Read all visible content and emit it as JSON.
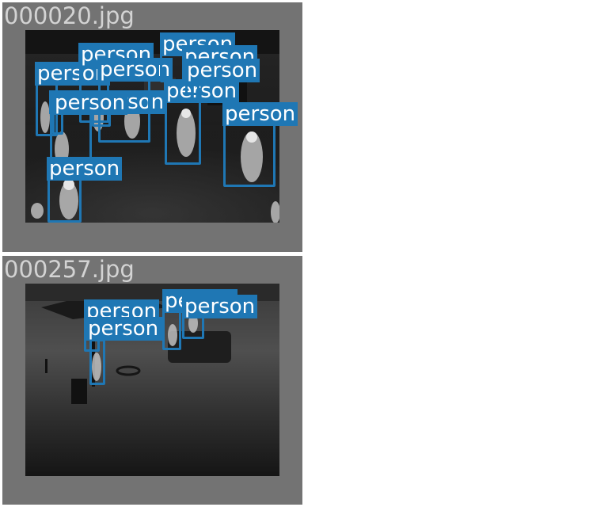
{
  "panels": [
    {
      "filename": "000020.jpg",
      "detections": [
        "person",
        "person",
        "person",
        "person",
        "person",
        "person",
        "person",
        "person",
        "person",
        "person",
        "person",
        "person"
      ]
    },
    {
      "filename": "000257.jpg",
      "detections": [
        "person",
        "person",
        "person",
        "person",
        "person"
      ]
    }
  ],
  "colors": {
    "box": "#1f77b4",
    "panel_bg": "#737373",
    "filename_text": "#d3d3d3",
    "label_text": "#ffffff"
  }
}
